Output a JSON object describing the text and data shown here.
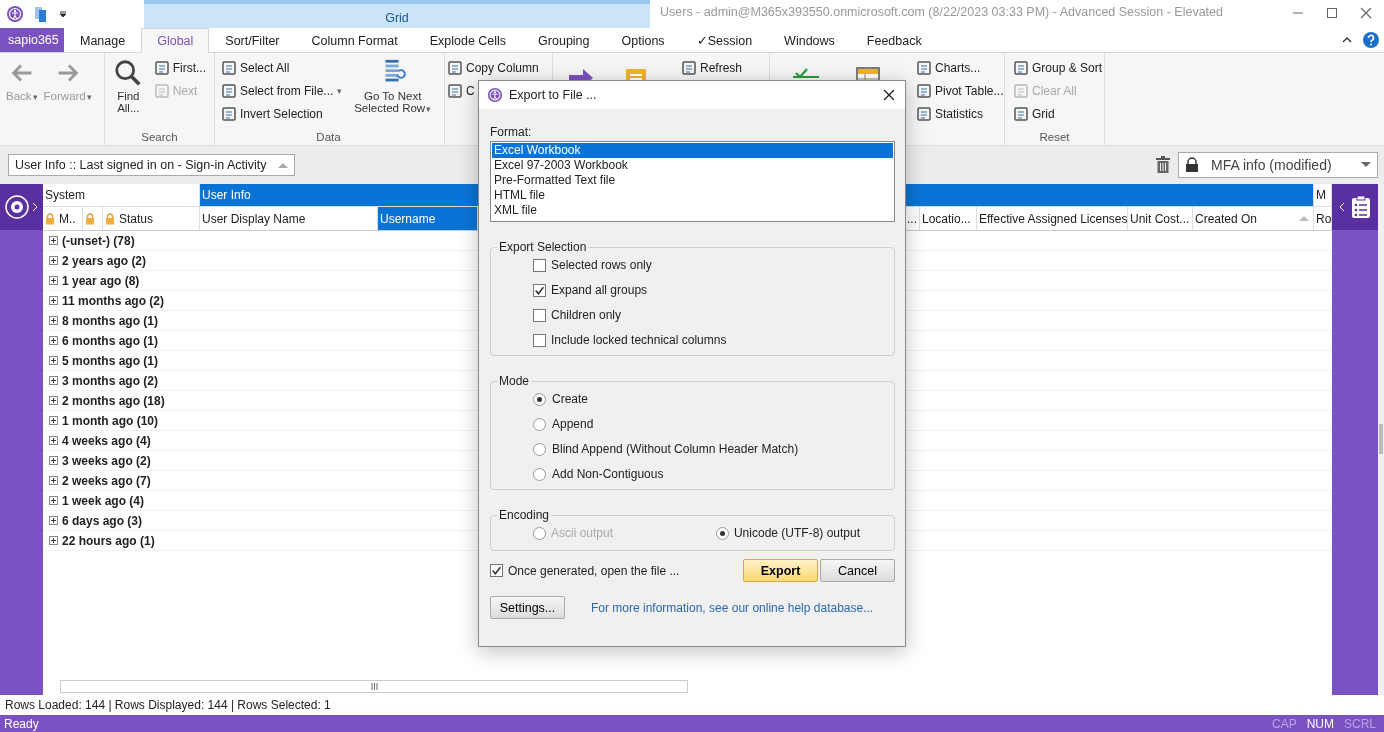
{
  "title_bar": {
    "contextual_tab": "Grid",
    "title": "Users - admin@M365x393550.onmicrosoft.com (8/22/2023 03:33 PM) - Advanced Session - Elevated"
  },
  "app_menu": "sapio365",
  "tabs": [
    {
      "label": "Manage",
      "selected": false
    },
    {
      "label": "Global",
      "selected": true
    },
    {
      "label": "Sort/Filter",
      "selected": false
    },
    {
      "label": "Column Format",
      "selected": false
    },
    {
      "label": "Explode Cells",
      "selected": false
    },
    {
      "label": "Grouping",
      "selected": false
    },
    {
      "label": "Options",
      "selected": false
    },
    {
      "label": "Session",
      "prefix": "✓",
      "selected": false
    },
    {
      "label": "Windows",
      "selected": false
    },
    {
      "label": "Feedback",
      "selected": false
    }
  ],
  "ribbon": {
    "groups": [
      {
        "columns": [
          [
            {
              "label": "Back",
              "kind": "large",
              "disabled": true,
              "caret": "▾"
            }
          ],
          [
            {
              "label": "Forward",
              "kind": "large",
              "disabled": true,
              "caret": "▾"
            }
          ]
        ]
      },
      {
        "label": "Search",
        "columns": [
          [
            {
              "label": "Find All...",
              "kind": "large",
              "disabled": false
            }
          ],
          [
            {
              "label": "First...",
              "kind": "small",
              "disabled": false
            },
            {
              "label": "Next",
              "kind": "small",
              "disabled": true
            }
          ]
        ]
      },
      {
        "label": "Data",
        "columns": [
          [
            {
              "label": "Select All",
              "kind": "small",
              "disabled": false
            },
            {
              "label": "Select from File...",
              "kind": "small",
              "disabled": false,
              "caret": "▾"
            },
            {
              "label": "Invert Selection",
              "kind": "small",
              "disabled": false
            }
          ],
          [
            {
              "label": "Go To Next Selected Row",
              "kind": "large",
              "disabled": false,
              "caret": "▾"
            }
          ]
        ]
      },
      {
        "columns": [
          [
            {
              "label": "Copy Column",
              "kind": "small",
              "disabled": false
            },
            {
              "label": "C",
              "kind": "small",
              "disabled": false
            }
          ]
        ]
      },
      {
        "columns": [
          [
            {
              "kind": "icon"
            }
          ],
          [
            {
              "kind": "icon"
            }
          ],
          [
            {
              "label": "Refresh",
              "kind": "small",
              "disabled": false
            }
          ]
        ]
      },
      {
        "columns": [
          [
            {
              "kind": "icon"
            }
          ],
          [
            {
              "kind": "icon"
            }
          ],
          [
            {
              "label": "Charts...",
              "kind": "small",
              "disabled": false
            },
            {
              "label": "Pivot Table...",
              "kind": "small",
              "disabled": false
            },
            {
              "label": "Statistics",
              "kind": "small",
              "disabled": false
            }
          ]
        ]
      },
      {
        "label": "Reset",
        "columns": [
          [
            {
              "label": "Group & Sort",
              "kind": "small",
              "disabled": false
            },
            {
              "label": "Clear All",
              "kind": "small",
              "disabled": true
            },
            {
              "label": "Grid",
              "kind": "small",
              "disabled": false
            }
          ]
        ]
      }
    ]
  },
  "toolbar": {
    "grouping_selector": "User Info :: Last signed in on - Sign-in Activity",
    "view_selector": "MFA info (modified)"
  },
  "grid": {
    "column_groups": [
      {
        "label": "System",
        "selected": false
      },
      {
        "label": "User Info",
        "selected": true
      },
      {
        "label": "M",
        "selected": false
      }
    ],
    "columns": [
      {
        "label": "M..",
        "locked": true,
        "selected": false,
        "sorted": false
      },
      {
        "locked": true,
        "selected": false,
        "sorted": false
      },
      {
        "label": "Status",
        "locked": true,
        "selected": false,
        "sorted": false
      },
      {
        "label": "User Display Name",
        "locked": false,
        "selected": false,
        "sorted": false
      },
      {
        "label": "Username",
        "locked": false,
        "selected": true,
        "sorted": false
      },
      {
        "label": "...",
        "locked": false,
        "selected": false,
        "sorted": false
      },
      {
        "label": "Locatio...",
        "locked": false,
        "selected": false,
        "sorted": false
      },
      {
        "label": "Effective Assigned Licenses",
        "locked": false,
        "selected": false,
        "sorted": false
      },
      {
        "label": "Unit Cost...",
        "locked": false,
        "selected": false,
        "sorted": false
      },
      {
        "label": "Created On",
        "locked": false,
        "selected": false,
        "sorted": true
      },
      {
        "label": "Ro",
        "locked": false,
        "selected": false,
        "sorted": false
      }
    ],
    "groups": [
      "(-unset-) (78)",
      "2 years ago (2)",
      "1 year ago (8)",
      "11 months ago (2)",
      "8 months ago (1)",
      "6 months ago (1)",
      "5 months ago (1)",
      "3 months ago (2)",
      "2 months ago (18)",
      "1 month ago (10)",
      "4 weeks ago (4)",
      "3 weeks ago (2)",
      "2 weeks ago (7)",
      "1 week ago (4)",
      "6 days ago (3)",
      "22 hours ago (1)"
    ]
  },
  "status_line": "Rows Loaded: 144 | Rows Displayed: 144 | Rows Selected: 1",
  "status_bar": {
    "text": "Ready",
    "indicators": [
      {
        "label": "CAP",
        "on": false
      },
      {
        "label": "NUM",
        "on": true
      },
      {
        "label": "SCRL",
        "on": false
      }
    ]
  },
  "dialog": {
    "title": "Export to File ...",
    "format_label": "Format:",
    "formats": [
      {
        "label": "Excel Workbook",
        "selected": true
      },
      {
        "label": "Excel 97-2003 Workbook",
        "selected": false
      },
      {
        "label": "Pre-Formatted Text file",
        "selected": false
      },
      {
        "label": "HTML file",
        "selected": false
      },
      {
        "label": "XML file",
        "selected": false
      }
    ],
    "export_selection": {
      "title": "Export Selection",
      "options": [
        {
          "label": "Selected rows only",
          "checked": false
        },
        {
          "label": "Expand all groups",
          "checked": true
        },
        {
          "label": "Children only",
          "checked": false
        },
        {
          "label": "Include locked technical columns",
          "checked": false
        }
      ]
    },
    "mode": {
      "title": "Mode",
      "options": [
        {
          "label": "Create",
          "selected": true
        },
        {
          "label": "Append",
          "selected": false
        },
        {
          "label": "Blind Append (Without Column Header Match)",
          "selected": false
        },
        {
          "label": "Add Non-Contiguous",
          "selected": false
        }
      ]
    },
    "encoding": {
      "title": "Encoding",
      "options": [
        {
          "label": "Ascii output",
          "selected": false,
          "disabled": true
        },
        {
          "label": "Unicode (UTF-8) output",
          "selected": true,
          "disabled": false
        }
      ]
    },
    "open_file": {
      "label": "Once generated, open the file ...",
      "checked": true
    },
    "buttons": [
      {
        "label": "Export",
        "kind": "primary"
      },
      {
        "label": "Cancel",
        "kind": "normal"
      }
    ],
    "settings_button": "Settings...",
    "help_link": "For more information, see our online help database..."
  }
}
